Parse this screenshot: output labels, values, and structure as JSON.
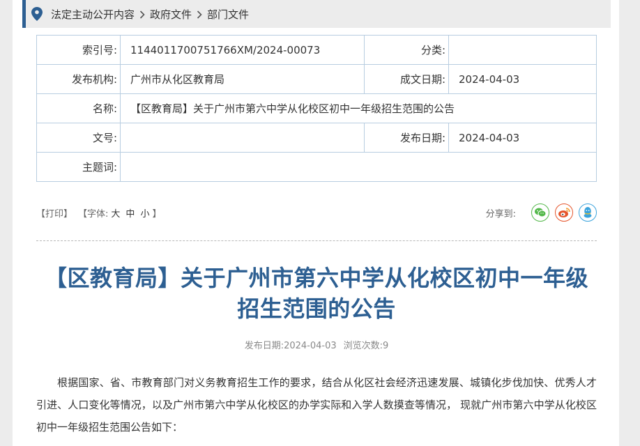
{
  "breadcrumb": {
    "items": [
      "法定主动公开内容",
      "政府文件",
      "部门文件"
    ]
  },
  "meta": {
    "index_label": "索引号:",
    "index_value": "1144011700751766XM/2024-00073",
    "category_label": "分类:",
    "category_value": "",
    "publisher_label": "发布机构:",
    "publisher_value": "广州市从化区教育局",
    "created_label": "成文日期:",
    "created_value": "2024-04-03",
    "name_label": "名称:",
    "name_value": "【区教育局】关于广州市第六中学从化校区初中一年级招生范围的公告",
    "docno_label": "文号:",
    "docno_value": "",
    "published_label": "发布日期:",
    "published_value": "2024-04-03",
    "subject_label": "主题词:",
    "subject_value": ""
  },
  "tools": {
    "print": "【打印】",
    "font_open": "【字体:",
    "font_large": "大",
    "font_medium": "中",
    "font_small": "小",
    "font_close": "】",
    "share_label": "分享到:"
  },
  "share_icons": {
    "wechat_color": "#53b84a",
    "weibo_color": "#e5552c",
    "qq_color": "#3aa3dc"
  },
  "article": {
    "title": "【区教育局】关于广州市第六中学从化校区初中一年级招生范围的公告",
    "pub_date_label": "发布日期:",
    "pub_date": "2024-04-03",
    "views_label": "浏览次数:",
    "views": "9",
    "body": "根据国家、省、市教育部门对义务教育招生工作的要求，结合从化区社会经济迅速发展、城镇化步伐加快、优秀人才引进、人口变化等情况，以及广州市第六中学从化校区的办学实际和入学人数摸查等情况， 现就广州市第六中学从化校区初中一年级招生范围公告如下："
  },
  "colors": {
    "accent": "#2d5f92",
    "table_border": "#b7cde0"
  }
}
